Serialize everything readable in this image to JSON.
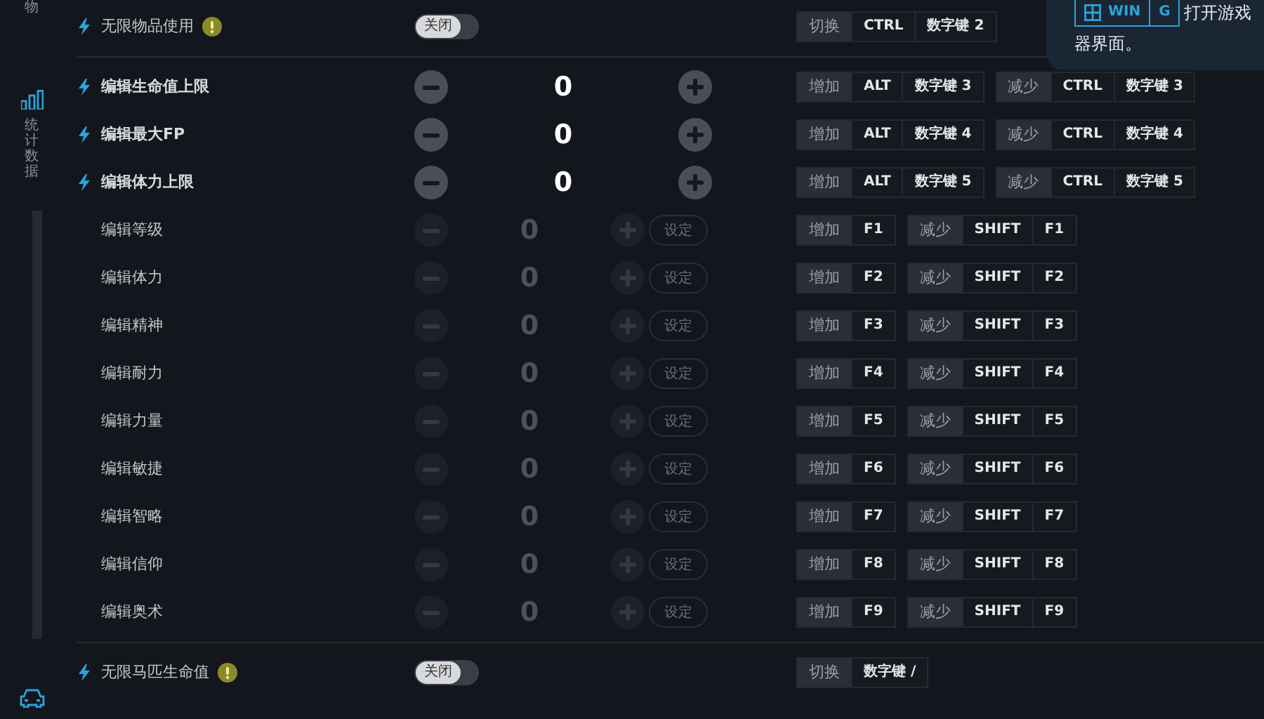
{
  "sidebar": {
    "items": [
      {
        "kind": "label",
        "label": "物",
        "selected": false
      },
      {
        "kind": "stats",
        "label": "统计数据",
        "selected": true
      },
      {
        "kind": "car",
        "selected": true
      }
    ]
  },
  "sections": [
    {
      "rows": [
        {
          "kind": "toggle",
          "bolt": true,
          "label": "无限物品使用",
          "warning": true,
          "toggle": {
            "label": "关闭",
            "on": false
          },
          "hotkeys": [
            {
              "action": "切换",
              "keys": [
                "CTRL",
                "数字键 2"
              ]
            }
          ]
        }
      ]
    },
    {
      "rows": [
        {
          "kind": "stepper",
          "bolt": true,
          "label": "编辑生命值上限",
          "value": "0",
          "disabled": false,
          "hotkeys": [
            {
              "action": "增加",
              "keys": [
                "ALT",
                "数字键 3"
              ]
            },
            {
              "action": "减少",
              "keys": [
                "CTRL",
                "数字键 3"
              ]
            }
          ]
        },
        {
          "kind": "stepper",
          "bolt": true,
          "label": "编辑最大FP",
          "value": "0",
          "disabled": false,
          "hotkeys": [
            {
              "action": "增加",
              "keys": [
                "ALT",
                "数字键 4"
              ]
            },
            {
              "action": "减少",
              "keys": [
                "CTRL",
                "数字键 4"
              ]
            }
          ]
        },
        {
          "kind": "stepper",
          "bolt": true,
          "label": "编辑体力上限",
          "value": "0",
          "disabled": false,
          "hotkeys": [
            {
              "action": "增加",
              "keys": [
                "ALT",
                "数字键 5"
              ]
            },
            {
              "action": "减少",
              "keys": [
                "CTRL",
                "数字键 5"
              ]
            }
          ]
        },
        {
          "kind": "stepper",
          "bolt": false,
          "label": "编辑等级",
          "value": "0",
          "disabled": true,
          "set_label": "设定",
          "hotkeys": [
            {
              "action": "增加",
              "keys": [
                "F1"
              ]
            },
            {
              "action": "减少",
              "keys": [
                "SHIFT",
                "F1"
              ]
            }
          ]
        },
        {
          "kind": "stepper",
          "bolt": false,
          "label": "编辑体力",
          "value": "0",
          "disabled": true,
          "set_label": "设定",
          "hotkeys": [
            {
              "action": "增加",
              "keys": [
                "F2"
              ]
            },
            {
              "action": "减少",
              "keys": [
                "SHIFT",
                "F2"
              ]
            }
          ]
        },
        {
          "kind": "stepper",
          "bolt": false,
          "label": "编辑精神",
          "value": "0",
          "disabled": true,
          "set_label": "设定",
          "hotkeys": [
            {
              "action": "增加",
              "keys": [
                "F3"
              ]
            },
            {
              "action": "减少",
              "keys": [
                "SHIFT",
                "F3"
              ]
            }
          ]
        },
        {
          "kind": "stepper",
          "bolt": false,
          "label": "编辑耐力",
          "value": "0",
          "disabled": true,
          "set_label": "设定",
          "hotkeys": [
            {
              "action": "增加",
              "keys": [
                "F4"
              ]
            },
            {
              "action": "减少",
              "keys": [
                "SHIFT",
                "F4"
              ]
            }
          ]
        },
        {
          "kind": "stepper",
          "bolt": false,
          "label": "编辑力量",
          "value": "0",
          "disabled": true,
          "set_label": "设定",
          "hotkeys": [
            {
              "action": "增加",
              "keys": [
                "F5"
              ]
            },
            {
              "action": "减少",
              "keys": [
                "SHIFT",
                "F5"
              ]
            }
          ]
        },
        {
          "kind": "stepper",
          "bolt": false,
          "label": "编辑敏捷",
          "value": "0",
          "disabled": true,
          "set_label": "设定",
          "hotkeys": [
            {
              "action": "增加",
              "keys": [
                "F6"
              ]
            },
            {
              "action": "减少",
              "keys": [
                "SHIFT",
                "F6"
              ]
            }
          ]
        },
        {
          "kind": "stepper",
          "bolt": false,
          "label": "编辑智略",
          "value": "0",
          "disabled": true,
          "set_label": "设定",
          "hotkeys": [
            {
              "action": "增加",
              "keys": [
                "F7"
              ]
            },
            {
              "action": "减少",
              "keys": [
                "SHIFT",
                "F7"
              ]
            }
          ]
        },
        {
          "kind": "stepper",
          "bolt": false,
          "label": "编辑信仰",
          "value": "0",
          "disabled": true,
          "set_label": "设定",
          "hotkeys": [
            {
              "action": "增加",
              "keys": [
                "F8"
              ]
            },
            {
              "action": "减少",
              "keys": [
                "SHIFT",
                "F8"
              ]
            }
          ]
        },
        {
          "kind": "stepper",
          "bolt": false,
          "label": "编辑奥术",
          "value": "0",
          "disabled": true,
          "set_label": "设定",
          "hotkeys": [
            {
              "action": "增加",
              "keys": [
                "F9"
              ]
            },
            {
              "action": "减少",
              "keys": [
                "SHIFT",
                "F9"
              ]
            }
          ]
        }
      ]
    },
    {
      "rows": [
        {
          "kind": "toggle",
          "bolt": true,
          "label": "无限马匹生命值",
          "warning": true,
          "toggle": {
            "label": "关闭",
            "on": false
          },
          "hotkeys": [
            {
              "action": "切换",
              "keys": [
                "数字键 /"
              ]
            }
          ]
        }
      ]
    }
  ],
  "tooltip": {
    "keys": [
      {
        "label": "WIN",
        "windows_logo": true
      },
      {
        "label": "G",
        "windows_logo": false
      }
    ],
    "lines": [
      "打开游戏",
      "器界面。"
    ]
  }
}
